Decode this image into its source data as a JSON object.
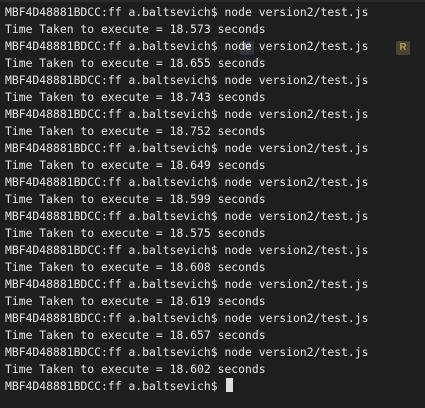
{
  "terminal": {
    "lines": [
      "MBF4D48881BDCC:ff a.baltsevich$ node version2/test.js",
      "Time Taken to execute = 18.573 seconds",
      "MBF4D48881BDCC:ff a.baltsevich$ node version2/test.js",
      "Time Taken to execute = 18.655 seconds",
      "MBF4D48881BDCC:ff a.baltsevich$ node version2/test.js",
      "Time Taken to execute = 18.743 seconds",
      "MBF4D48881BDCC:ff a.baltsevich$ node version2/test.js",
      "Time Taken to execute = 18.752 seconds",
      "MBF4D48881BDCC:ff a.baltsevich$ node version2/test.js",
      "Time Taken to execute = 18.649 seconds",
      "MBF4D48881BDCC:ff a.baltsevich$ node version2/test.js",
      "Time Taken to execute = 18.599 seconds",
      "MBF4D48881BDCC:ff a.baltsevich$ node version2/test.js",
      "Time Taken to execute = 18.575 seconds",
      "MBF4D48881BDCC:ff a.baltsevich$ node version2/test.js",
      "Time Taken to execute = 18.608 seconds",
      "MBF4D48881BDCC:ff a.baltsevich$ node version2/test.js",
      "Time Taken to execute = 18.619 seconds",
      "MBF4D48881BDCC:ff a.baltsevich$ node version2/test.js",
      "Time Taken to execute = 18.657 seconds",
      "MBF4D48881BDCC:ff a.baltsevich$ node version2/test.js",
      "Time Taken to execute = 18.602 seconds"
    ],
    "prompt": "MBF4D48881BDCC:ff a.baltsevich$ "
  },
  "colors": {
    "background": "#1e1e1e",
    "text": "#e8e8e8",
    "cursor": "#dcdcdc"
  }
}
